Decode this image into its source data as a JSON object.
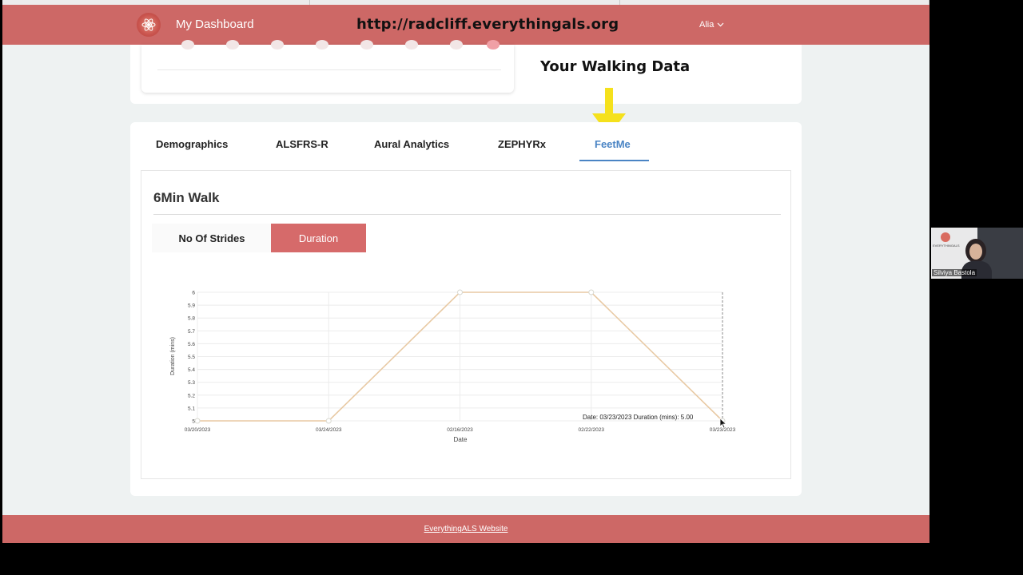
{
  "header": {
    "app_title": "My Dashboard",
    "overlay_url": "http://radcliff.everythingals.org",
    "user_name": "Alia"
  },
  "top_section": {
    "walking_title": "Your Walking  Data"
  },
  "tabs": [
    {
      "label": "Demographics",
      "active": false
    },
    {
      "label": "ALSFRS-R",
      "active": false
    },
    {
      "label": "Aural Analytics",
      "active": false
    },
    {
      "label": "ZEPHYRx",
      "active": false
    },
    {
      "label": "FeetMe",
      "active": true
    }
  ],
  "panel": {
    "title": "6Min Walk",
    "buttons": {
      "strides": "No Of Strides",
      "duration": "Duration"
    }
  },
  "chart_data": {
    "type": "line",
    "x": [
      "03/20/2023",
      "03/24/2023",
      "02/16/2023",
      "02/22/2023",
      "03/23/2023"
    ],
    "values": [
      5,
      5,
      6,
      6,
      5
    ],
    "xlabel": "Date",
    "ylabel": "Duration (mins)",
    "ylim": [
      5,
      6
    ],
    "y_ticks": [
      "5",
      "5.1",
      "5.2",
      "5.3",
      "5.4",
      "5.5",
      "5.6",
      "5.7",
      "5.8",
      "5.9",
      "6"
    ],
    "grid": true,
    "line_color": "#e8c9a3",
    "tooltip": {
      "date_label": "Date:",
      "date": "03/23/2023",
      "value_label": "Duration (mins):",
      "value": "5.00"
    }
  },
  "footer": {
    "link": "EverythingALS Website"
  },
  "video": {
    "participant_name": "Silviya Bastola",
    "logo_text": "EVERYTHINGALS"
  },
  "colors": {
    "brand": "#cd6866",
    "active_tab": "#4a84c4",
    "active_button": "#d66a6a",
    "arrow": "#f5e11c"
  }
}
